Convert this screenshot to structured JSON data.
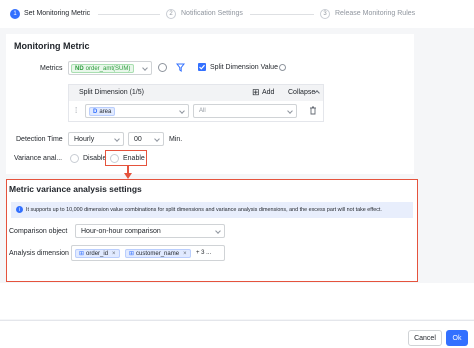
{
  "steps": [
    {
      "num": "1",
      "label": "Set Monitoring Metric"
    },
    {
      "num": "2",
      "label": "Notification Settings"
    },
    {
      "num": "3",
      "label": "Release Monitoring Rules"
    }
  ],
  "monitoring": {
    "title": "Monitoring Metric",
    "metrics_label": "Metrics",
    "metric_prefix": "ND",
    "metric_value": "order_amt(SUM)",
    "split_checkbox_label": "Split Dimension Value",
    "split_dimension": {
      "header": "Split Dimension (1/5)",
      "add_label": "Add",
      "collapse_label": "Collapse",
      "dimension_value": "area",
      "dimension_prefix": "D",
      "all_placeholder": "All"
    },
    "detection_time_label": "Detection Time",
    "detection_freq": "Hourly",
    "detection_minute": "00",
    "detection_unit": "Min.",
    "variance_label": "Variance anal...",
    "disable_label": "Disable",
    "enable_label": "Enable"
  },
  "variance_settings": {
    "title": "Metric variance analysis settings",
    "info_text": "It supports up to 10,000 dimension value combinations for split dimensions and variance analysis dimensions, and the excess part will not take effect.",
    "comparison_label": "Comparison object",
    "comparison_value": "Hour-on-hour comparison",
    "analysis_label": "Analysis dimension",
    "dimensions": [
      "order_id",
      "customer_name"
    ],
    "more_label": "+ 3 ..."
  },
  "footer": {
    "cancel_label": "Cancel",
    "ok_label": "Ok"
  },
  "colors": {
    "accent": "#3370ff",
    "highlight_border": "#e5533d",
    "metric_tag": "#e8f7ea"
  }
}
